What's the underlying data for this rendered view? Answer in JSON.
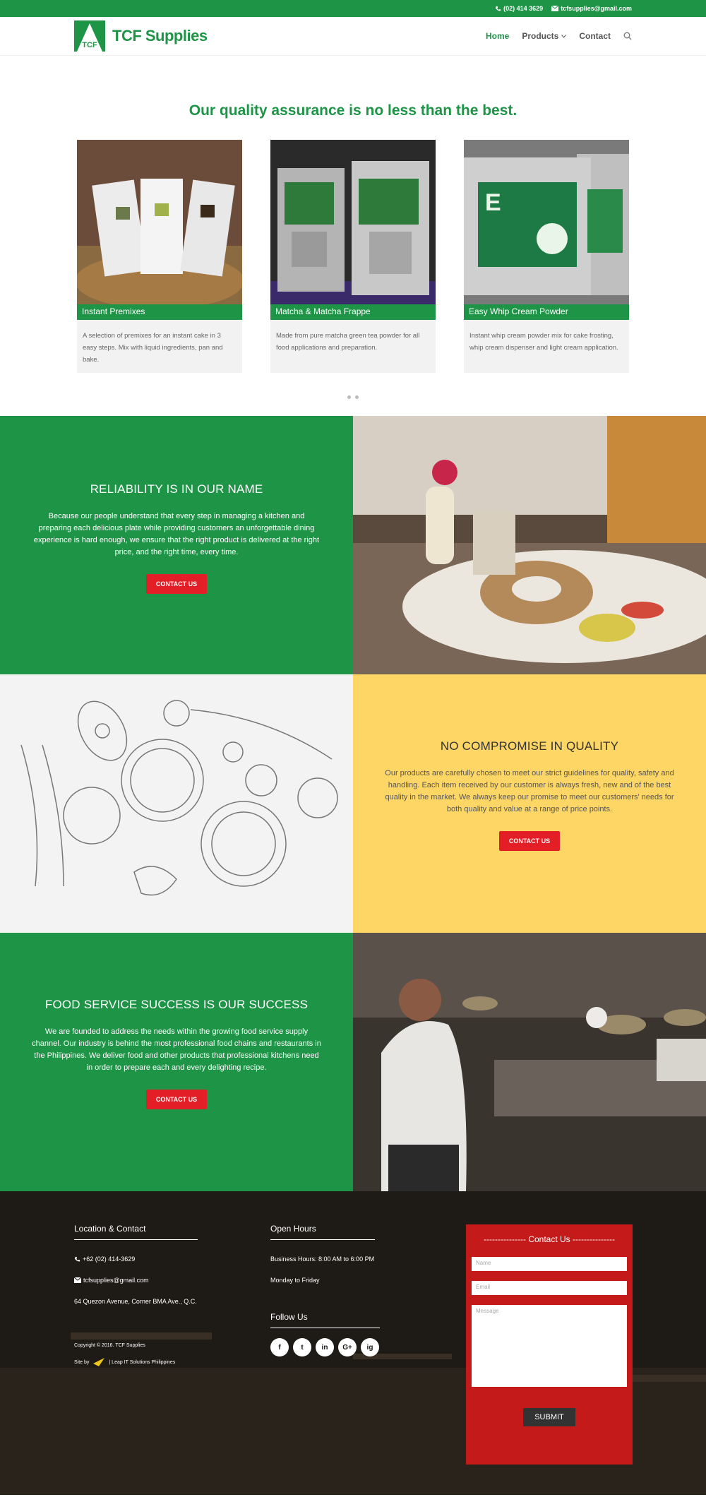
{
  "topbar": {
    "phone": "(02) 414 3629",
    "email": "tcfsupplies@gmail.com"
  },
  "header": {
    "logo_text": "TCF Supplies",
    "logo_mark_text": "TCF",
    "nav": {
      "home": "Home",
      "products": "Products",
      "contact": "Contact"
    }
  },
  "hero": {
    "title": "Our quality assurance is no less than the best."
  },
  "products": [
    {
      "name": "Instant Premixes",
      "desc": "A selection of premixes for an instant cake in 3 easy steps. Mix with liquid ingredients, pan and bake."
    },
    {
      "name": "Matcha & Matcha Frappe",
      "desc": "Made from pure matcha green tea powder for all food applications and preparation."
    },
    {
      "name": "Easy Whip Cream Powder",
      "desc": "Instant whip cream powder mix for cake frosting, whip cream dispenser and light cream application."
    }
  ],
  "sections": [
    {
      "title": "RELIABILITY IS IN OUR NAME",
      "body": "Because our people understand that every step in managing a kitchen and preparing each delicious plate while providing customers an unforgettable dining experience is hard enough, we ensure that the right product is delivered at the right price, and the right time, every time.",
      "button": "CONTACT US"
    },
    {
      "title": "NO COMPROMISE IN QUALITY",
      "body": "Our products are carefully chosen to meet our strict guidelines for quality, safety and handling. Each item received by our customer is always fresh, new and of the best quality in the market. We always keep our promise to meet our customers' needs for both quality and value at a range of price points.",
      "button": "CONTACT US"
    },
    {
      "title": "FOOD SERVICE SUCCESS IS OUR SUCCESS",
      "body": "We are founded to address the needs within the growing food service supply channel. Our industry is behind the most professional food chains and restaurants in the Philippines. We deliver food and other products that professional kitchens need in order to prepare each and every delighting recipe.",
      "button": "CONTACT US"
    }
  ],
  "footer": {
    "location_heading": "Location & Contact",
    "phone": "+62 (02) 414-3629",
    "email": "tcfsupplies@gmail.com",
    "address": "64 Quezon Avenue, Corner BMA Ave., Q.C.",
    "copyright": "Copyright © 2016. TCF Supplies",
    "site_by": "Site by",
    "site_by_company": "| Leap IT Solutions Philippines",
    "hours_heading": "Open Hours",
    "hours": "Business Hours: 8:00 AM to 6:00 PM",
    "days": "Monday to Friday",
    "follow_heading": "Follow Us",
    "social": [
      "f",
      "t",
      "in",
      "G+",
      "ig"
    ],
    "form": {
      "title": "--------------- Contact Us ---------------",
      "name_ph": "Name",
      "email_ph": "Email",
      "message_ph": "Message",
      "submit": "SUBMIT"
    }
  }
}
